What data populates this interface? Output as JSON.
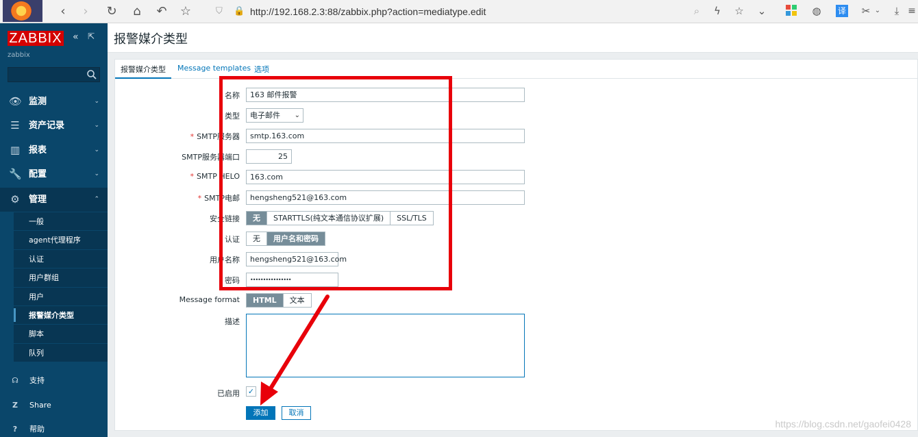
{
  "browser": {
    "url": "http://192.168.2.3:88/zabbix.php?action=mediatype.edit"
  },
  "sidebar": {
    "logo": "ZABBIX",
    "server_name": "zabbix",
    "search_placeholder": "",
    "menu": [
      {
        "label": "监测",
        "icon": "eye-icon"
      },
      {
        "label": "资产记录",
        "icon": "list-icon"
      },
      {
        "label": "报表",
        "icon": "bar-chart-icon"
      },
      {
        "label": "配置",
        "icon": "wrench-icon"
      },
      {
        "label": "管理",
        "icon": "gear-icon"
      }
    ],
    "submenu": [
      "一般",
      "agent代理程序",
      "认证",
      "用户群组",
      "用户",
      "报警媒介类型",
      "脚本",
      "队列"
    ],
    "bottom": [
      {
        "label": "支持",
        "icon": "headset-icon"
      },
      {
        "label": "Share",
        "icon": "zabbix-share-icon"
      },
      {
        "label": "帮助",
        "icon": "help-icon"
      }
    ]
  },
  "page": {
    "title": "报警媒介类型",
    "tabs": [
      "报警媒介类型",
      "Message templates",
      "选项"
    ]
  },
  "form": {
    "name_label": "名称",
    "name_value": "163 邮件报警",
    "type_label": "类型",
    "type_value": "电子邮件",
    "smtp_server_label": "SMTP服务器",
    "smtp_server_value": "smtp.163.com",
    "smtp_port_label": "SMTP服务器端口",
    "smtp_port_value": "25",
    "smtp_helo_label": "SMTP HELO",
    "smtp_helo_value": "163.com",
    "smtp_email_label": "SMTP电邮",
    "smtp_email_value": "hengsheng521@163.com",
    "security_label": "安全链接",
    "security_options": [
      "无",
      "STARTTLS(纯文本通信协议扩展)",
      "SSL/TLS"
    ],
    "security_selected": "无",
    "auth_label": "认证",
    "auth_options": [
      "无",
      "用户名和密码"
    ],
    "auth_selected": "用户名和密码",
    "username_label": "用户名称",
    "username_value": "hengsheng521@163.com",
    "password_label": "密码",
    "password_value": "••••••••••••••••",
    "format_label": "Message format",
    "format_options": [
      "HTML",
      "文本"
    ],
    "format_selected": "HTML",
    "description_label": "描述",
    "description_value": "",
    "enabled_label": "已启用",
    "enabled": true,
    "add_button": "添加",
    "cancel_button": "取消"
  },
  "annotation_color": "#e8000a",
  "watermark": "https://blog.csdn.net/gaofei0428"
}
